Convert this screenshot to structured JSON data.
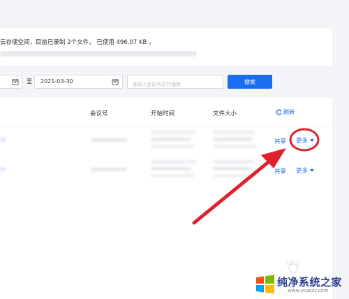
{
  "info": {
    "storage_text": "云存储空间，目前已录制 2个文件， 已使用 496.07 KB 。"
  },
  "filters": {
    "start_date": "",
    "to_label": "至",
    "end_date": "2021-03-30",
    "search_placeholder": "请输入会议号进行搜索",
    "search_button": "搜索"
  },
  "table": {
    "headers": {
      "meeting_id": "会议号",
      "start_time": "开始时间",
      "file_size": "文件大小",
      "refresh": "刷新"
    },
    "rows": [
      {
        "share": "共享",
        "more": "更多"
      },
      {
        "share": "共享",
        "more": "更多"
      }
    ]
  },
  "colors": {
    "accent": "#1a6df0",
    "annotation": "#e0202a",
    "page_bg": "#f4f5f8"
  },
  "watermark": {
    "name": "纯净系统之家",
    "url": "www.ycwjzy.com"
  },
  "icons": [
    "calendar-icon",
    "refresh-icon",
    "chevron-down-icon",
    "windows-logo"
  ]
}
